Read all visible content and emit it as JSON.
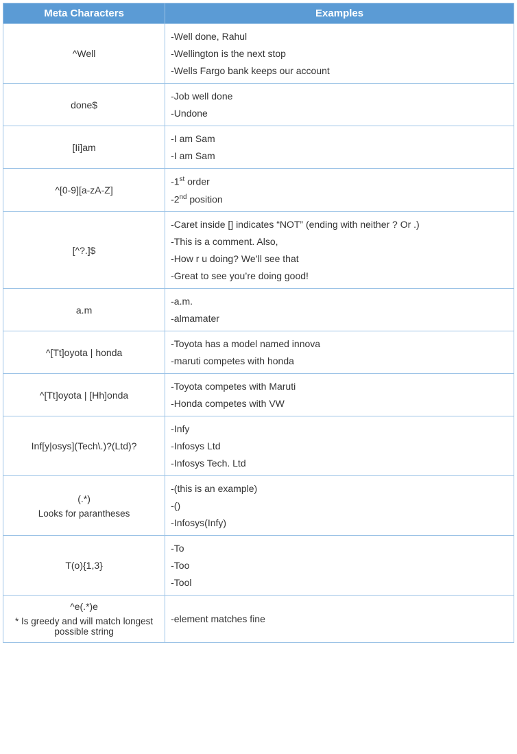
{
  "headers": {
    "col1": "Meta Characters",
    "col2": "Examples"
  },
  "rows": [
    {
      "pattern": "^Well",
      "note": "",
      "examples": [
        "-Well done, Rahul",
        "-Wellington is the next stop",
        "-Wells Fargo bank keeps our account"
      ]
    },
    {
      "pattern": "done$",
      "note": "",
      "examples": [
        "-Job well done",
        "-Undone"
      ]
    },
    {
      "pattern": "[Ii]am",
      "note": "",
      "examples": [
        "-I am Sam",
        "-I am Sam"
      ]
    },
    {
      "pattern": "^[0-9][a-zA-Z]",
      "note": "",
      "examples": [
        "-1<sup>st</sup> order",
        "-2<sup>nd</sup> position"
      ]
    },
    {
      "pattern": "[^?.]$",
      "note": "",
      "examples": [
        "-Caret inside [] indicates “NOT” (ending with neither ? Or .)",
        "-This is a comment. Also,",
        "-How r u doing? We’ll see that",
        "-Great to see you’re doing good!"
      ]
    },
    {
      "pattern": "a.m",
      "note": "",
      "examples": [
        "-a.m.",
        "-almamater"
      ]
    },
    {
      "pattern": "^[Tt]oyota | honda",
      "note": "",
      "examples": [
        "-Toyota has a model named innova",
        "-maruti competes with honda"
      ]
    },
    {
      "pattern": "^[Tt]oyota | [Hh]onda",
      "note": "",
      "examples": [
        "-Toyota competes with Maruti",
        "-Honda competes with VW"
      ]
    },
    {
      "pattern": "Inf[y|osys](Tech\\.)?(Ltd)?",
      "note": "",
      "examples": [
        "-Infy",
        "-Infosys Ltd",
        "-Infosys Tech. Ltd"
      ]
    },
    {
      "pattern": "(.*)",
      "note": "Looks for parantheses",
      "examples": [
        "-(this is an example)",
        "-()",
        "-Infosys(Infy)"
      ]
    },
    {
      "pattern": "T(o){1,3}",
      "note": "",
      "examples": [
        "-To",
        "-Too",
        "-Tool"
      ]
    },
    {
      "pattern": "^e(.*)e",
      "note": "* Is greedy and will match longest possible string",
      "examples": [
        "-element matches fine"
      ]
    }
  ]
}
